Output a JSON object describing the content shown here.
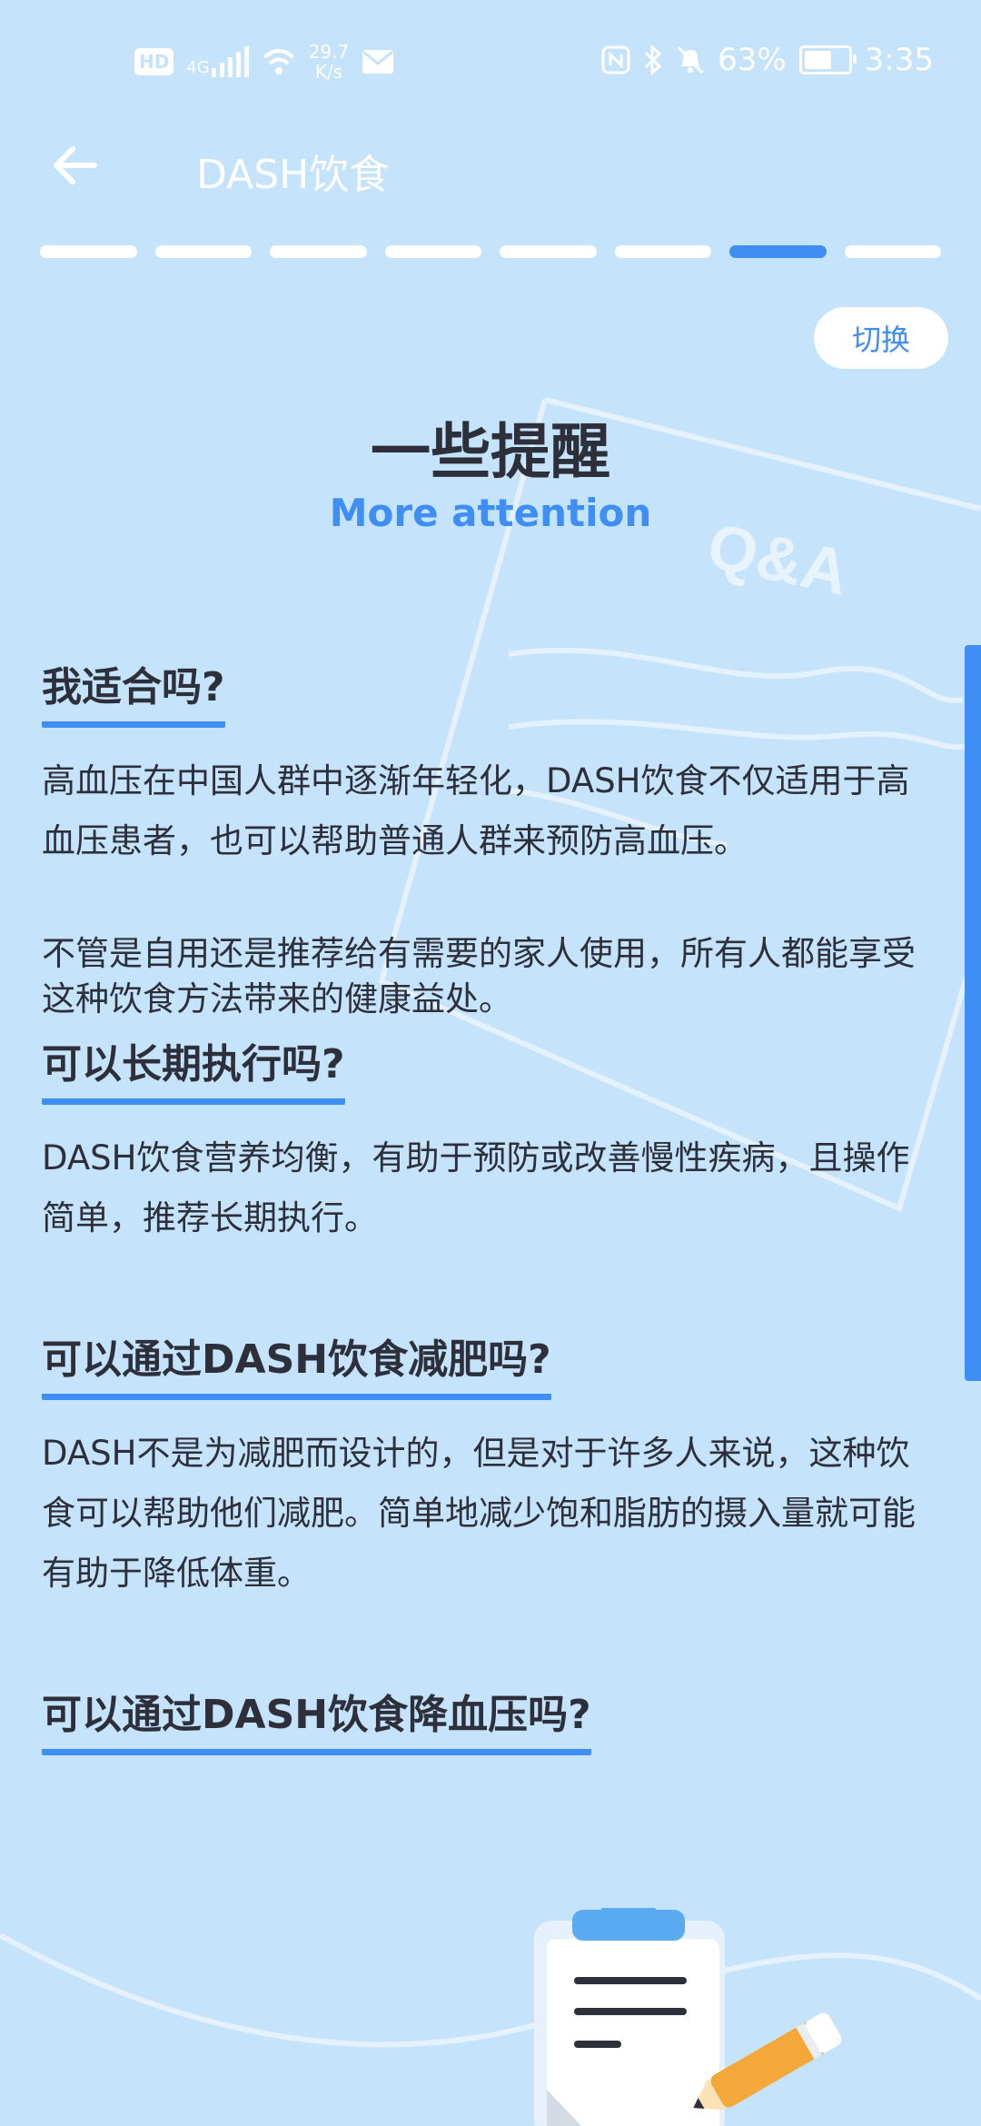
{
  "status_bar": {
    "hd": "HD",
    "net": "4G",
    "speed_value": "29.7",
    "speed_unit": "K/s",
    "battery": "63%",
    "time": "3:35",
    "battery_level": 0.63
  },
  "header": {
    "title": "DASH饮食"
  },
  "progress": {
    "total": 8,
    "current": 7
  },
  "switch_label": "切换",
  "hero": {
    "title": "一些提醒",
    "subtitle": "More attention",
    "watermark": "Q&A"
  },
  "sections": [
    {
      "heading": "我适合吗?",
      "paragraphs": [
        "高血压在中国人群中逐渐年轻化，DASH饮食不仅适用于高血压患者，也可以帮助普通人群来预防高血压。",
        "不管是自用还是推荐给有需要的家人使用，所有人都能享受这种饮食方法带来的健康益处。"
      ]
    },
    {
      "heading": "可以长期执行吗?",
      "paragraphs": [
        "DASH饮食营养均衡，有助于预防或改善慢性疾病，且操作简单，推荐长期执行。"
      ]
    },
    {
      "heading": "可以通过DASH饮食减肥吗?",
      "paragraphs": [
        "DASH不是为减肥而设计的，但是对于许多人来说，这种饮食可以帮助他们减肥。简单地减少饱和脂肪的摄入量就可能有助于降低体重。"
      ]
    },
    {
      "heading": "可以通过DASH饮食降血压吗?",
      "paragraphs": []
    }
  ],
  "colors": {
    "background": "#c5e3fb",
    "accent": "#3e8ef3",
    "text": "#2d2f3b"
  }
}
